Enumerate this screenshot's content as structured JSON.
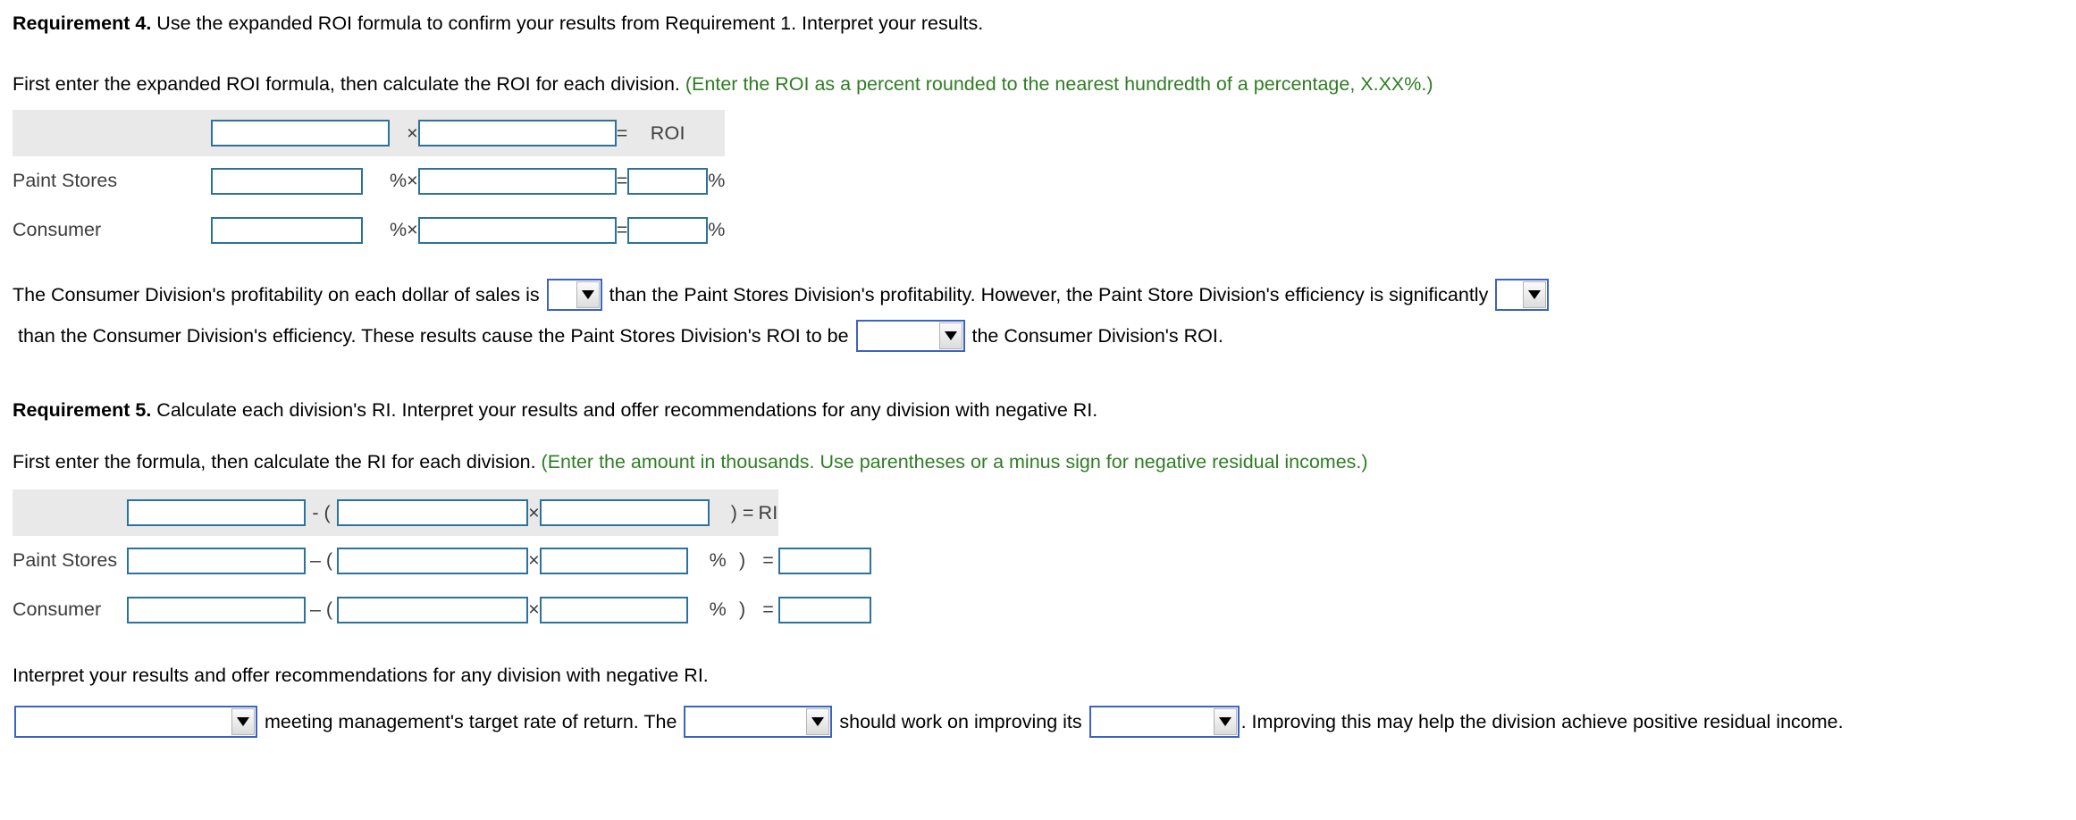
{
  "colors": {
    "input_border": "#2c7299",
    "select_border": "#3b63c4",
    "header_bg": "#e9e9e9",
    "hint_green": "#2e7d23",
    "text": "#000000"
  },
  "requirement4": {
    "heading_label": "Requirement 4.",
    "heading_text": " Use the expanded ROI formula to confirm your results from Requirement 1. Interpret your results.",
    "instruction_text": "First enter the expanded ROI formula, then calculate the ROI for each division. ",
    "instruction_hint": "(Enter the ROI as a percent rounded to the nearest hundredth of a percentage, X.XX%.)",
    "table": {
      "header": {
        "label": "",
        "factor1_placeholder": "",
        "operator_multiply": "×",
        "factor2_placeholder": "",
        "operator_equals": "=",
        "result_label": "ROI"
      },
      "rows": [
        {
          "label": "Paint Stores",
          "factor1": "",
          "factor1_suffix": "%",
          "operator_multiply": "×",
          "factor2": "",
          "operator_equals": "=",
          "result": "",
          "result_suffix": "%"
        },
        {
          "label": "Consumer",
          "factor1": "",
          "factor1_suffix": "%",
          "operator_multiply": "×",
          "factor2": "",
          "operator_equals": "=",
          "result": "",
          "result_suffix": "%"
        }
      ]
    },
    "interpretation": {
      "seg1": "The Consumer Division's profitability on each dollar of sales is ",
      "dropdown1_value": "",
      "seg2": " than the Paint Stores Division's profitability. However, the Paint Store Division's efficiency is significantly ",
      "dropdown2_value": "",
      "seg3": " than the Consumer Division's efficiency. These results cause the Paint Stores Division's ROI to be ",
      "dropdown3_value": "",
      "seg4": " the Consumer Division's ROI."
    }
  },
  "requirement5": {
    "heading_label": "Requirement 5.",
    "heading_text": " Calculate each division's RI. Interpret your results and offer recommendations for any division with negative RI.",
    "instruction_text": "First enter the formula, then calculate the RI for each division. ",
    "instruction_hint": "(Enter the amount in thousands. Use parentheses or a minus sign for negative residual incomes.)",
    "table": {
      "header": {
        "label": "",
        "term1_placeholder": "",
        "operator_minus_paren": "- (",
        "term2_placeholder": "",
        "operator_multiply": "×",
        "term3_placeholder": "",
        "operator_close_equals": ") =",
        "result_label": "RI"
      },
      "rows": [
        {
          "label": "Paint Stores",
          "term1": "",
          "operator_minus_paren": "– (",
          "term2": "",
          "operator_multiply": "×",
          "term3": "",
          "term3_suffix": "%",
          "close_paren": ")",
          "operator_equals": "=",
          "result": ""
        },
        {
          "label": "Consumer",
          "term1": "",
          "operator_minus_paren": "– (",
          "term2": "",
          "operator_multiply": "×",
          "term3": "",
          "term3_suffix": "%",
          "close_paren": ")",
          "operator_equals": "=",
          "result": ""
        }
      ]
    },
    "interpretation_prompt": "Interpret your results and offer recommendations for any division with negative RI.",
    "interpretation": {
      "dropdown1_value": "",
      "seg1": " meeting management's target rate of return. The ",
      "dropdown2_value": "",
      "seg2": " should work on improving its ",
      "dropdown3_value": "",
      "seg3": ". Improving this may help the division achieve positive residual income."
    }
  }
}
